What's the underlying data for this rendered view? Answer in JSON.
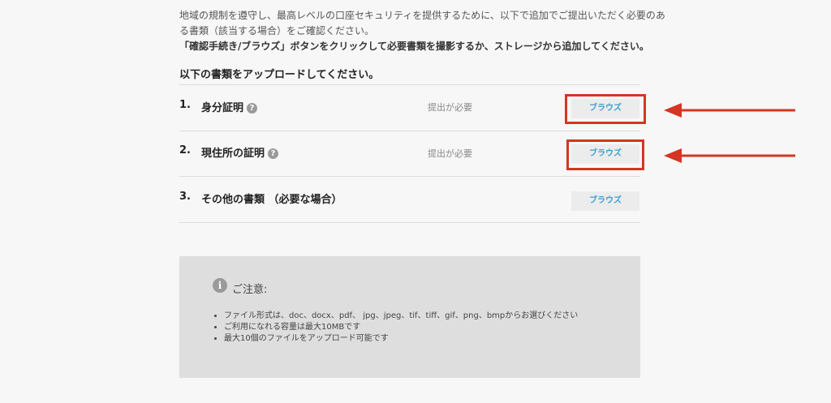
{
  "intro": {
    "line1": "地域の規制を遵守し、最高レベルの口座セキュリティを提供するために、以下で追加でご提出いただく必要のあ",
    "line2": "る書類（該当する場合）をご確認ください。",
    "line3": "「確認手続き/ブラウズ」ボタンをクリックして必要書類を撮影するか、ストレージから追加してください。"
  },
  "upload": {
    "title": "以下の書類をアップロードしてください。",
    "rows": [
      {
        "number": "1.",
        "label": "身分証明",
        "status": "提出が必要",
        "button": "ブラウズ",
        "help_icon": "question-circle-icon"
      },
      {
        "number": "2.",
        "label": "現住所の証明",
        "status": "提出が必要",
        "button": "ブラウズ",
        "help_icon": "question-circle-icon"
      },
      {
        "number": "3.",
        "label": "その他の書類 （必要な場合）",
        "button": "ブラウズ"
      }
    ],
    "help_glyph": "?"
  },
  "notice": {
    "icon": "info-icon",
    "icon_glyph": "i",
    "title": "ご注意:",
    "items": [
      "ファイル形式は、doc、docx、pdf、 jpg、jpeg、tif、tiff、gif、png、bmpからお選びください",
      "ご利用になれる容量は最大10MBです",
      "最大10個のファイルをアップロード可能です"
    ]
  },
  "annotation_color": "#d43624"
}
